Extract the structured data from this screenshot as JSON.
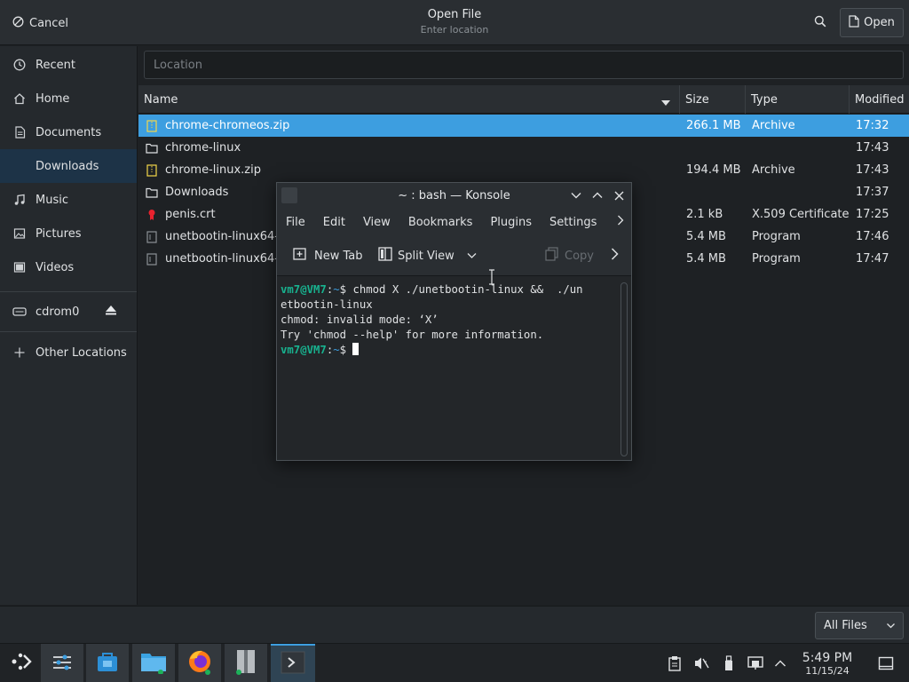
{
  "dialog": {
    "cancel_label": "Cancel",
    "title": "Open File",
    "subtitle": "Enter location",
    "open_label": "Open",
    "location_placeholder": "Location"
  },
  "sidebar": {
    "items": [
      {
        "label": "Recent",
        "icon": "clock-icon"
      },
      {
        "label": "Home",
        "icon": "home-icon"
      },
      {
        "label": "Documents",
        "icon": "documents-icon"
      },
      {
        "label": "Downloads",
        "icon": "downloads-icon",
        "active": true
      },
      {
        "label": "Music",
        "icon": "music-icon"
      },
      {
        "label": "Pictures",
        "icon": "pictures-icon"
      },
      {
        "label": "Videos",
        "icon": "videos-icon"
      }
    ],
    "device": {
      "label": "cdrom0",
      "icon": "drive-icon"
    },
    "other_locations": "Other Locations"
  },
  "columns": {
    "name": "Name",
    "size": "Size",
    "type": "Type",
    "modified": "Modified"
  },
  "files": [
    {
      "name": "chrome-chromeos.zip",
      "size": "266.1 MB",
      "type": "Archive",
      "modified": "17:32",
      "icon": "zip-icon",
      "selected": true
    },
    {
      "name": "chrome-linux",
      "size": "",
      "type": "",
      "modified": "17:43",
      "icon": "folder-icon"
    },
    {
      "name": "chrome-linux.zip",
      "size": "194.4 MB",
      "type": "Archive",
      "modified": "17:43",
      "icon": "zip-icon"
    },
    {
      "name": "Downloads",
      "size": "",
      "type": "",
      "modified": "17:37",
      "icon": "folder-icon"
    },
    {
      "name": "penis.crt",
      "size": "2.1 kB",
      "type": "X.509 Certificate",
      "modified": "17:25",
      "icon": "certificate-icon"
    },
    {
      "name": "unetbootin-linux64-",
      "size": "5.4 MB",
      "type": "Program",
      "modified": "17:46",
      "icon": "program-icon"
    },
    {
      "name": "unetbootin-linux64-",
      "size": "5.4 MB",
      "type": "Program",
      "modified": "17:47",
      "icon": "program-icon"
    }
  ],
  "filter": {
    "selected": "All Files"
  },
  "konsole": {
    "title": "~ : bash — Konsole",
    "menu": [
      "File",
      "Edit",
      "View",
      "Bookmarks",
      "Plugins",
      "Settings"
    ],
    "toolbar": {
      "new_tab": "New Tab",
      "split_view": "Split View",
      "copy": "Copy"
    },
    "terminal": {
      "prompt_user": "vm7@VM7",
      "prompt_path": "~",
      "command_line1": "$ chmod X ./unetbootin-linux &&  ./un",
      "command_line2": "etbootin-linux",
      "output1": "chmod: invalid mode: ‘X’",
      "output2": "Try 'chmod --help' for more information.",
      "prompt_end": "$ "
    }
  },
  "clock": {
    "time": "5:49 PM",
    "date": "11/15/24"
  },
  "colors": {
    "accent": "#3d9ee0",
    "prompt_green": "#18b28f",
    "background": "#1e2124"
  }
}
